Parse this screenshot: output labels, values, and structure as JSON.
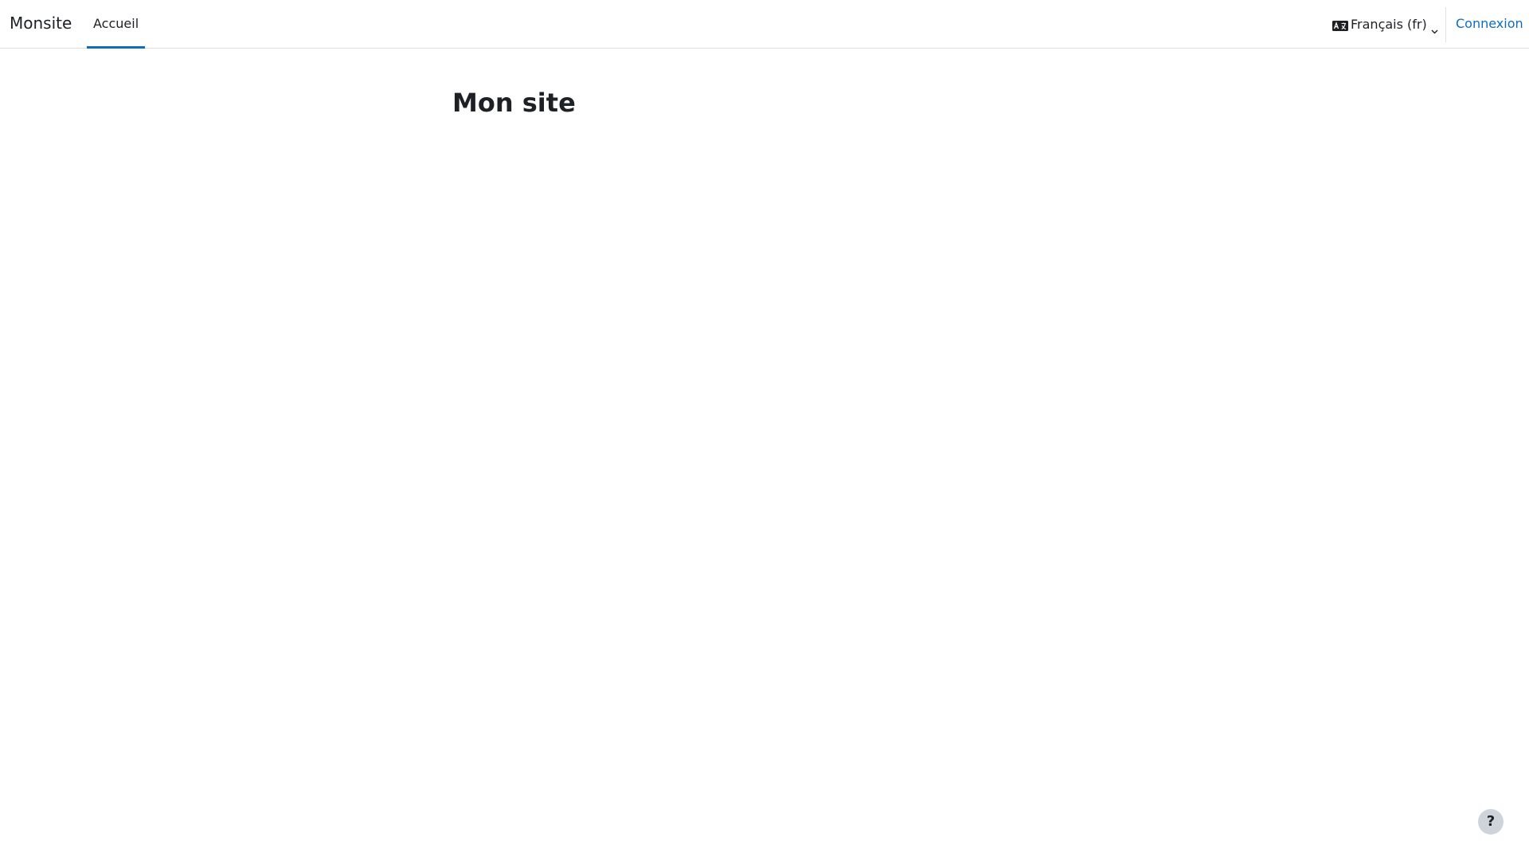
{
  "header": {
    "brand": "Monsite",
    "nav_tabs": [
      {
        "label": "Accueil",
        "active": true
      }
    ],
    "language": {
      "label": "Français (fr)",
      "icon": "language-icon"
    },
    "login_label": "Connexion"
  },
  "main": {
    "title": "Mon site"
  },
  "footer": {
    "help_label": "?"
  },
  "colors": {
    "accent": "#0f6cbf",
    "text": "#1d2125",
    "border": "#dee2e6",
    "help_bg": "#ced4da"
  }
}
